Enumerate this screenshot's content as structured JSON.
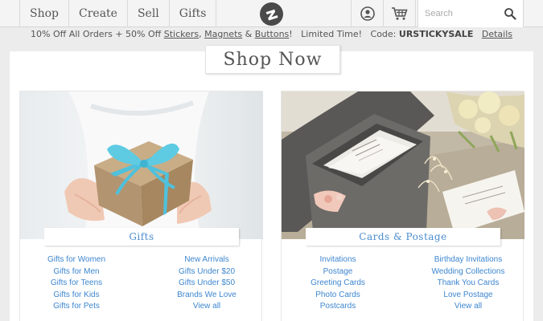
{
  "header": {
    "nav": [
      {
        "label": "Shop"
      },
      {
        "label": "Create"
      },
      {
        "label": "Sell"
      },
      {
        "label": "Gifts"
      }
    ],
    "search_placeholder": "Search"
  },
  "promo": {
    "prefix": "10% Off All Orders + 50% Off ",
    "link1": "Stickers",
    "sep1": ", ",
    "link2": "Magnets",
    "sep2": " & ",
    "link3": "Buttons",
    "suffix": "!   Limited Time!   Code: ",
    "code": "URSTICKYSALE",
    "details": "Details"
  },
  "main": {
    "heading": "Shop Now",
    "cards": [
      {
        "title": "Gifts",
        "col1": [
          "Gifts for Women",
          "Gifts for Men",
          "Gifts for Teens",
          "Gifts for Kids",
          "Gifts for Pets"
        ],
        "col2": [
          "New Arrivals",
          "Gifts Under $20",
          "Gifts Under $50",
          "Brands We Love",
          "View all"
        ]
      },
      {
        "title": "Cards & Postage",
        "col1": [
          "Invitations",
          "Postage",
          "Greeting Cards",
          "Photo Cards",
          "Postcards"
        ],
        "col2": [
          "Birthday Invitations",
          "Wedding Collections",
          "Thank You Cards",
          "Love Postage",
          "View all"
        ]
      }
    ]
  },
  "colors": {
    "link": "#3d86cf",
    "title": "#4a8ccf",
    "ribbon": "#5ec8e0",
    "box": "#b89a72"
  }
}
